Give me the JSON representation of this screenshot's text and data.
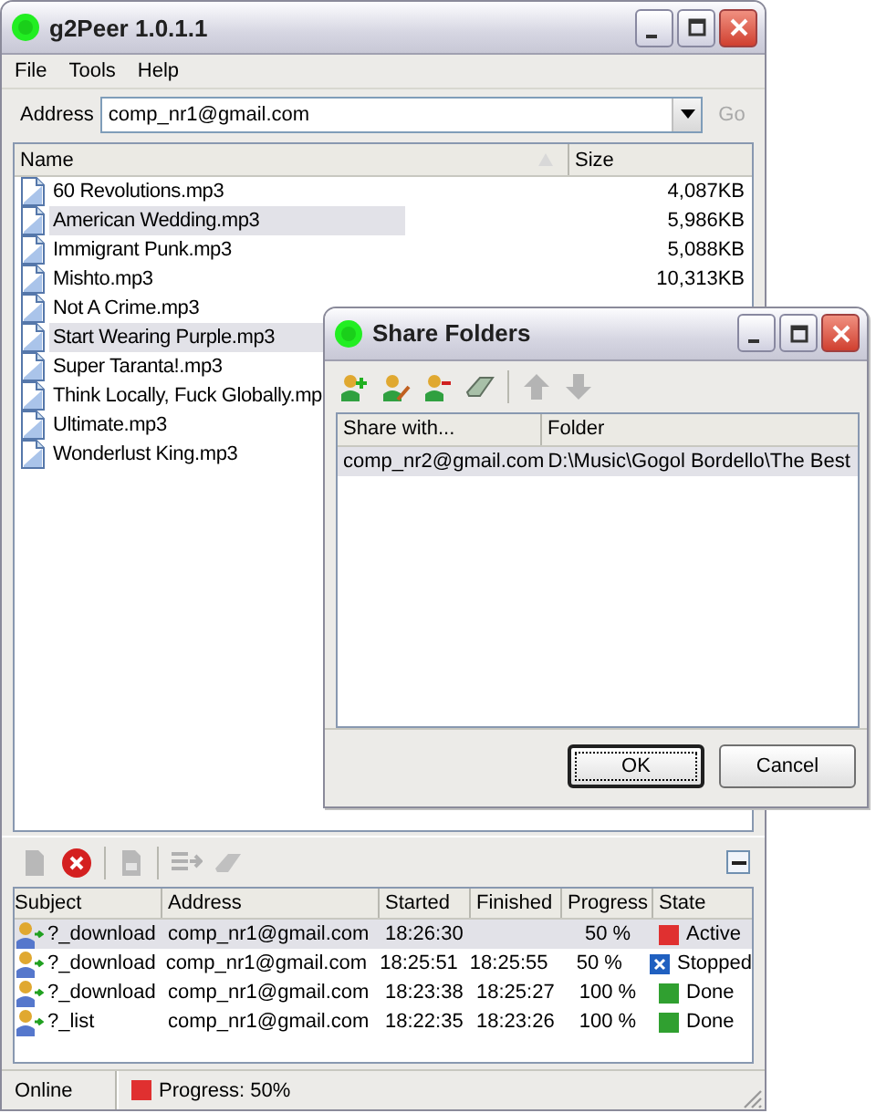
{
  "window": {
    "title": "g2Peer 1.0.1.1"
  },
  "menu": [
    "File",
    "Tools",
    "Help"
  ],
  "address": {
    "label": "Address",
    "value": "comp_nr1@gmail.com",
    "go_label": "Go",
    "go_disabled": true
  },
  "file_list": {
    "columns": [
      "Name",
      "Size"
    ],
    "rows": [
      {
        "name": "60 Revolutions.mp3",
        "size": "4,087KB",
        "selected": false
      },
      {
        "name": "American Wedding.mp3",
        "size": "5,986KB",
        "selected": true
      },
      {
        "name": "Immigrant Punk.mp3",
        "size": "5,088KB",
        "selected": false
      },
      {
        "name": "Mishto.mp3",
        "size": "10,313KB",
        "selected": false
      },
      {
        "name": "Not A Crime.mp3",
        "selected": false
      },
      {
        "name": "Start Wearing Purple.mp3",
        "selected": true
      },
      {
        "name": "Super Taranta!.mp3",
        "selected": false
      },
      {
        "name": "Think Locally, Fuck Globally.mp",
        "selected": false
      },
      {
        "name": "Ultimate.mp3",
        "selected": false
      },
      {
        "name": "Wonderlust King.mp3",
        "selected": false
      }
    ]
  },
  "transfers": {
    "columns": [
      "Subject",
      "Address",
      "Started",
      "Finished",
      "Progress",
      "State"
    ],
    "rows": [
      {
        "subject": "?_download",
        "address": "comp_nr1@gmail.com",
        "started": "18:26:30",
        "progress": "50 %",
        "state": "Active",
        "kind": "active",
        "selected": true
      },
      {
        "subject": "?_download",
        "address": "comp_nr1@gmail.com",
        "started": "18:25:51",
        "finished": "18:25:55",
        "progress": "50 %",
        "state": "Stopped",
        "kind": "stopped",
        "selected": false
      },
      {
        "subject": "?_download",
        "address": "comp_nr1@gmail.com",
        "started": "18:23:38",
        "finished": "18:25:27",
        "progress": "100 %",
        "state": "Done",
        "kind": "done",
        "selected": false
      },
      {
        "subject": "?_list",
        "address": "comp_nr1@gmail.com",
        "started": "18:22:35",
        "finished": "18:23:26",
        "progress": "100 %",
        "state": "Done",
        "kind": "done",
        "selected": false
      }
    ]
  },
  "status_bar": {
    "connection": "Online",
    "progress": "Progress: 50%"
  },
  "dialog": {
    "title": "Share Folders",
    "columns": [
      "Share with...",
      "Folder"
    ],
    "rows": [
      {
        "share_with": "comp_nr2@gmail.com",
        "folder": "D:\\Music\\Gogol Bordello\\The Best",
        "selected": true
      }
    ],
    "buttons": [
      {
        "label": "OK",
        "default": true
      },
      {
        "label": "Cancel",
        "default": false
      }
    ]
  }
}
